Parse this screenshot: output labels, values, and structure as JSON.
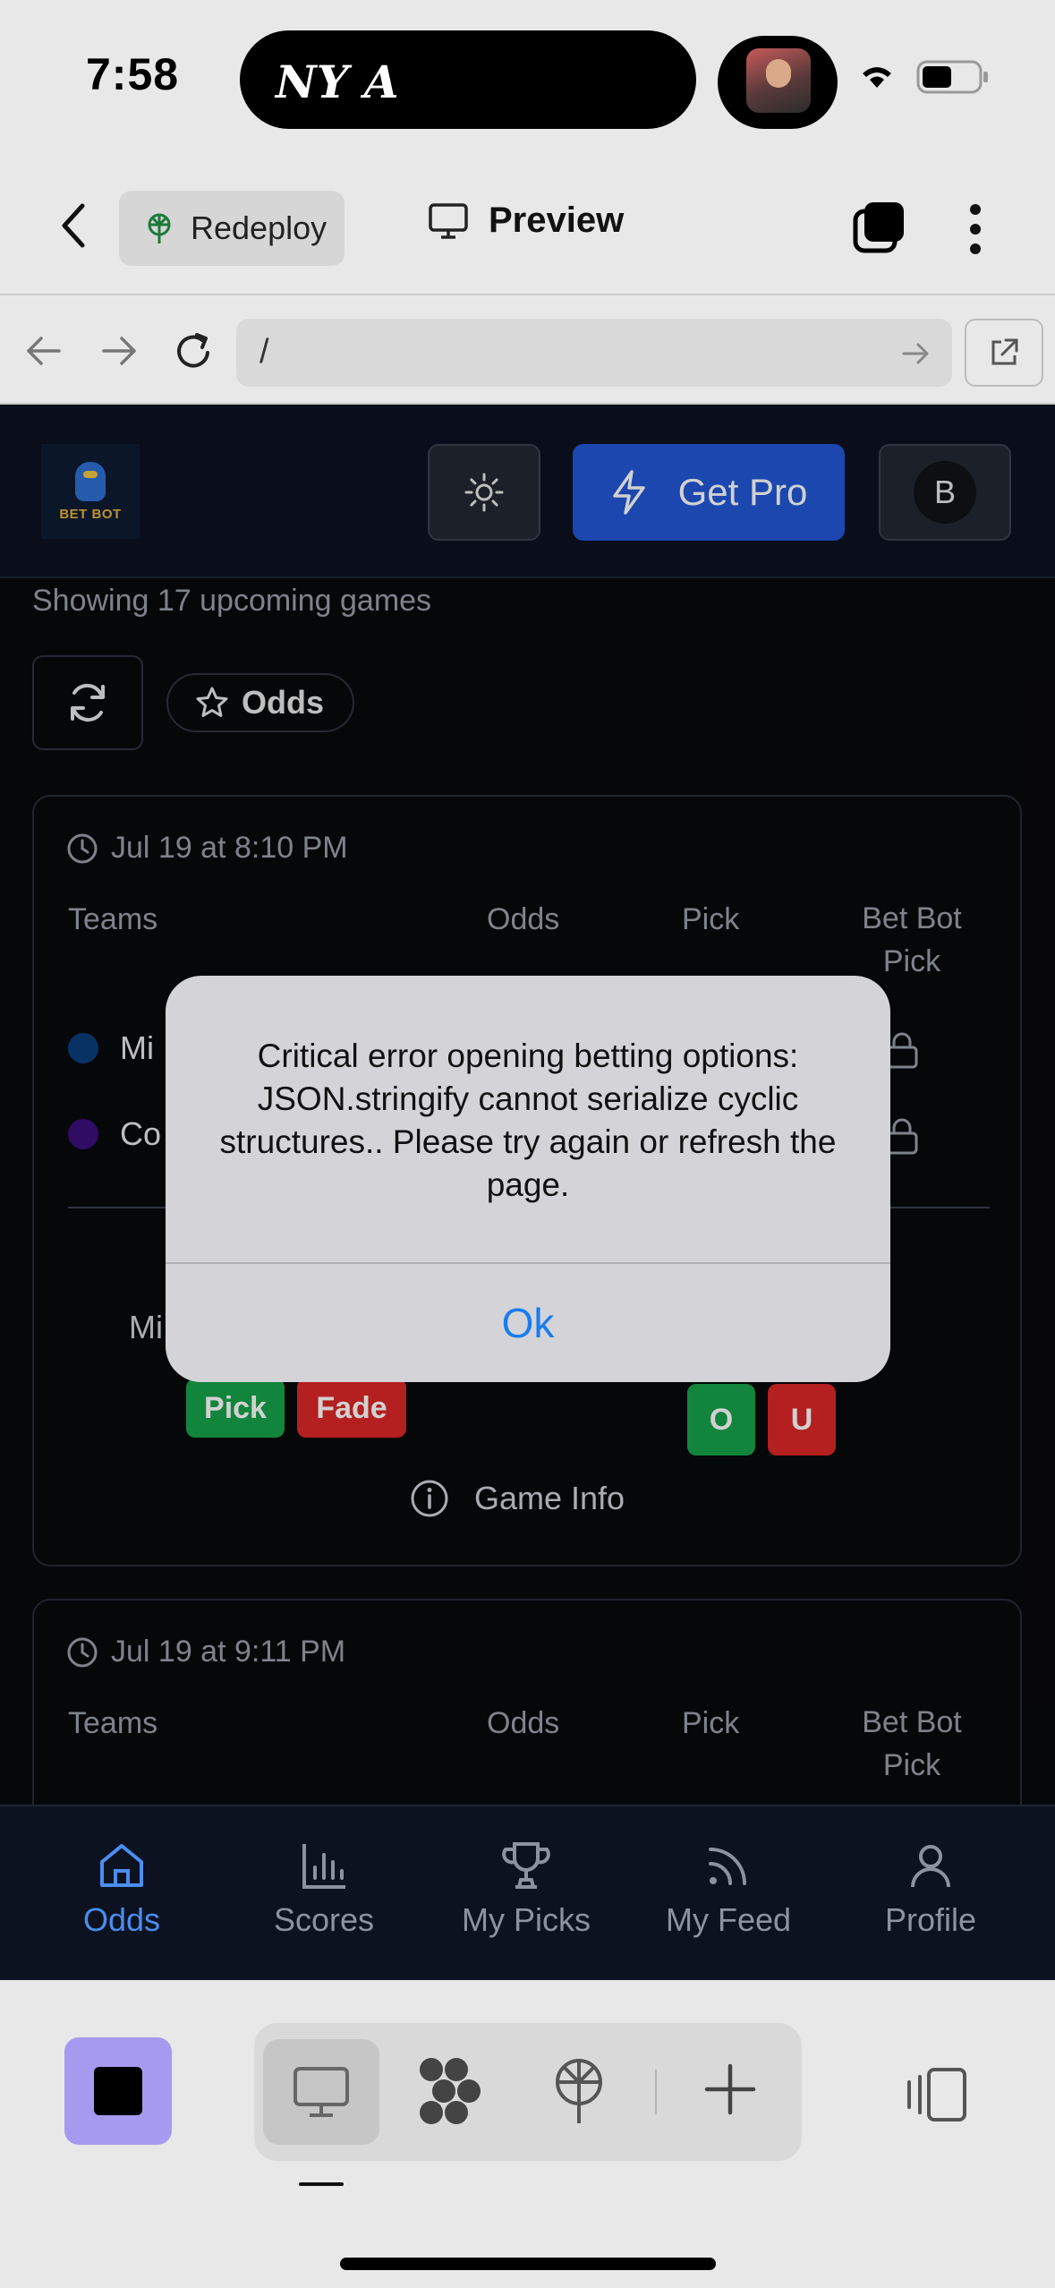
{
  "status_bar": {
    "time": "7:58",
    "ny_logo": "NY A"
  },
  "app_header": {
    "redeploy_label": "Redeploy",
    "preview_label": "Preview"
  },
  "browser": {
    "url": "/"
  },
  "site": {
    "logo_text": "BET BOT",
    "get_pro_label": "Get Pro",
    "account_initial": "B",
    "showing_text": "Showing 17 upcoming games",
    "odds_filter_label": "Odds",
    "columns": {
      "teams": "Teams",
      "odds": "Odds",
      "pick": "Pick",
      "betbot_pick": "Bet Bot Pick"
    },
    "games": [
      {
        "time": "Jul 19 at 8:10 PM",
        "teams": [
          {
            "name": "Mi",
            "color": "#0b3d7a"
          },
          {
            "name": "Co",
            "color": "#3b0f7a"
          }
        ],
        "pick_partial": "Mi",
        "pick_label": "Pick",
        "fade_label": "Fade",
        "over_label": "O",
        "under_label": "U",
        "game_info_label": "Game Info"
      },
      {
        "time": "Jul 19 at 9:11 PM"
      }
    ]
  },
  "tabs": [
    {
      "label": "Odds",
      "icon": "home-icon",
      "active": true
    },
    {
      "label": "Scores",
      "icon": "bar-chart-icon",
      "active": false
    },
    {
      "label": "My Picks",
      "icon": "trophy-icon",
      "active": false
    },
    {
      "label": "My Feed",
      "icon": "rss-icon",
      "active": false
    },
    {
      "label": "Profile",
      "icon": "user-icon",
      "active": false
    }
  ],
  "alert": {
    "message": "Critical error opening betting options: JSON.stringify cannot serialize cyclic structures.. Please try again or refresh the page.",
    "ok_label": "Ok"
  },
  "colors": {
    "accent_blue": "#2257d6",
    "active_tab": "#4a8ef0",
    "pick_green": "#16a34a",
    "fade_red": "#dc2626",
    "alert_link": "#1a7cf0"
  }
}
